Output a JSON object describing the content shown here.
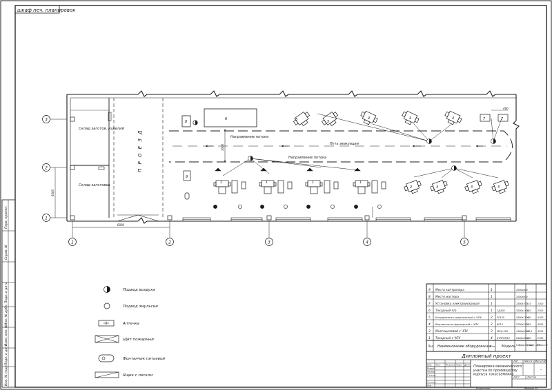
{
  "sheet_label": "шкаф печ. планировок",
  "plan": {
    "zones": {
      "storage_blanks": "Склад заготов. изделий",
      "storage_parts": "Склад заготовок",
      "passage": "П Р О Е З Д"
    },
    "flow_labels": {
      "top": "Направление потока",
      "bottom": "Направление потока",
      "path": "Путь эвакуации"
    },
    "row_axes": [
      "3",
      "2",
      "1"
    ],
    "col_axes": [
      "1",
      "2",
      "3",
      "4",
      "5"
    ],
    "dims": {
      "bay_height": "6000",
      "bay_width": "6000",
      "aisle": "3000",
      "edge": "400"
    },
    "machine_numbers": {
      "top_row": [
        "8",
        "6",
        "5",
        "5",
        "4",
        "4",
        "4",
        "7",
        "7"
      ],
      "bottom_row_left": [
        "1",
        "1",
        "1",
        "1"
      ],
      "bottom_row_right": [
        "2",
        "3",
        "3",
        "3"
      ],
      "side": [
        "9"
      ]
    }
  },
  "legend": [
    {
      "symbol": "air-supply",
      "label": "Подвод воздуха"
    },
    {
      "symbol": "emulsion-supply",
      "label": "Подвод эмульсии"
    },
    {
      "symbol": "first-aid-kit",
      "label": "Аптечка"
    },
    {
      "symbol": "fire-shield",
      "label": "Щит пожарный"
    },
    {
      "symbol": "drinking-fountain",
      "label": "Фонтанчик питьевой"
    },
    {
      "symbol": "sand-box",
      "label": "Ящик с песком"
    }
  ],
  "spec_table": {
    "rows": [
      {
        "pos": "9",
        "name": "Место контролера",
        "qty": "1",
        "model": "",
        "size": "1000х800",
        "power": "",
        "area": ""
      },
      {
        "pos": "8",
        "name": "Место мастера",
        "qty": "1",
        "model": "",
        "size": "1000х800",
        "power": "",
        "area": ""
      },
      {
        "pos": "7",
        "name": "Установка электроискровая",
        "qty": "1",
        "model": "",
        "size": "1400х700",
        "power": "0,4",
        "area": "1300"
      },
      {
        "pos": "6",
        "name": "Токарный п/а",
        "qty": "1",
        "model": "1Д426",
        "size": "3200х1400",
        "power": "5,5",
        "area": "2300"
      },
      {
        "pos": "5",
        "name": "Координатно-сверлильный с ЧПУ",
        "qty": "2",
        "model": "2Р135",
        "size": "2400х1300",
        "power": "4,0",
        "area": "4100"
      },
      {
        "pos": "4",
        "name": "Вертикально-фрезерный с ЧПУ",
        "qty": "3",
        "model": "6Р13",
        "size": "2700х2300",
        "power": "7,5",
        "area": "4200"
      },
      {
        "pos": "3",
        "name": "Многоцелевой с ЧПУ",
        "qty": "3",
        "model": "МСЦ-250",
        "size": "1400х2000",
        "power": "10,0",
        "area": "4300"
      },
      {
        "pos": "1",
        "name": "Токарный с ЧПУ",
        "qty": "4",
        "model": "АТПР2М12",
        "size": "2400х2000",
        "power": "8,0",
        "area": "2700"
      }
    ],
    "header": {
      "pos": "Поз.",
      "name": "Наименование оборудования",
      "qty": "Кол.",
      "model": "Модель",
      "size": "Габариты, мм",
      "power": "Мощн. кВт",
      "area": "Масса кг"
    }
  },
  "title_block": {
    "project": "Дипломный проект",
    "description": "Планировка механического участка по производству корпуса токосъемника",
    "col_headers": [
      "Изм.",
      "Лист",
      "№ докум.",
      "Подп.",
      "Дата"
    ],
    "row_labels": [
      "Разраб.",
      "Провер.",
      "Т.контр.",
      "",
      "Н.контр.",
      "Утв."
    ],
    "lit_headers": [
      "Лит.",
      "Масса",
      "Масштаб"
    ],
    "sheet": "Лист",
    "sheets": "Листов",
    "scale": "-",
    "org": "Копировал",
    "format": "Формат А1"
  },
  "side_stamp": [
    "Перв. примен.",
    "Справ. №",
    "Подп. и дата",
    "Инв. № дубл.",
    "Взам. инв. №",
    "Подп. и дата",
    "Инв. № подл."
  ]
}
